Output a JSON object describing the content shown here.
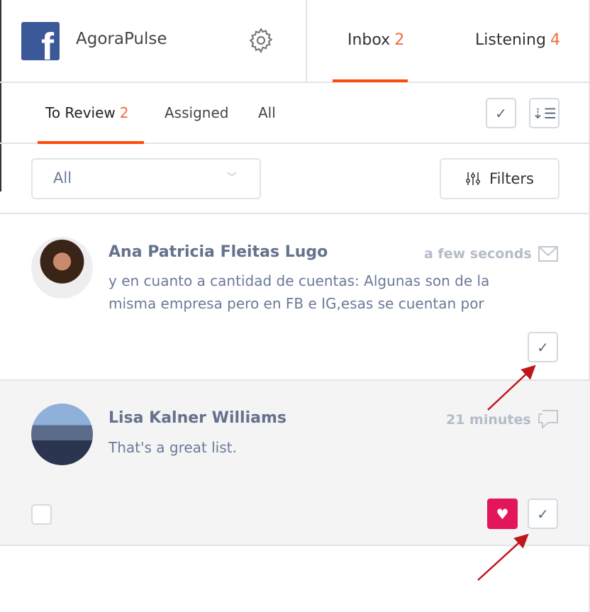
{
  "header": {
    "account_name": "AgoraPulse",
    "network_icon": "facebook-icon",
    "tabs": [
      {
        "label": "Inbox",
        "count": "2",
        "active": true
      },
      {
        "label": "Listening",
        "count": "4"
      }
    ]
  },
  "subtabs": [
    {
      "label": "To Review",
      "count": "2",
      "active": true
    },
    {
      "label": "Assigned"
    },
    {
      "label": "All"
    }
  ],
  "toolbar": {
    "select_value": "All",
    "filters_label": "Filters"
  },
  "items": [
    {
      "name": "Ana Patricia Fleitas Lugo",
      "time": "a few seconds",
      "type_icon": "envelope-icon",
      "message": "y en cuanto a cantidad de cuentas: Algunas son de la misma empresa pero en FB e IG,esas se cuentan por"
    },
    {
      "name": "Lisa Kalner Williams",
      "time": "21 minutes",
      "type_icon": "comment-icon",
      "message": "That's a great list.",
      "liked": true
    }
  ],
  "colors": {
    "accent": "#ff4b0a",
    "badge": "#f26a3d",
    "like": "#e3165b",
    "annotation_arrow": "#c0161b"
  }
}
